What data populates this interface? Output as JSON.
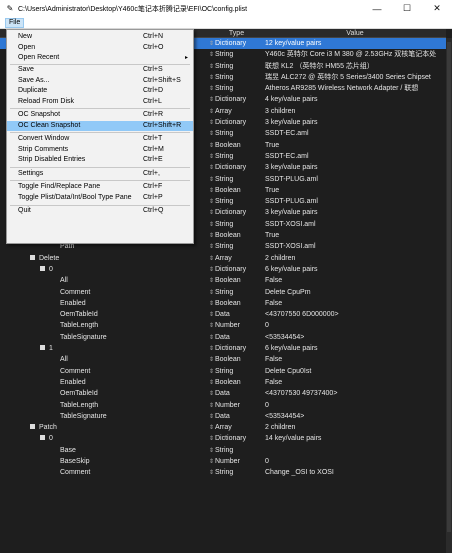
{
  "window": {
    "title": "C:\\Users\\Administrator\\Desktop\\Y460c笔记本折腾记录\\EFI\\OC\\config.plist",
    "app_icon": "pencil-icon",
    "minimize": "—",
    "maximize": "☐",
    "close": "✕"
  },
  "menubar": {
    "file": "File"
  },
  "columns": {
    "type": "Type",
    "value": "Value"
  },
  "rows": [
    {
      "key": "",
      "type": "Dictionary",
      "value": "12 key/value pairs",
      "selected": true
    },
    {
      "key": "",
      "type": "String",
      "value": "Y460c  英特尔 Core i3 M 380 @ 2.53GHz 双核笔记本处"
    },
    {
      "key": "",
      "type": "String",
      "value": "联想 KL2 （英特尔 HM55 芯片组）"
    },
    {
      "key": "",
      "type": "String",
      "value": "瑞昱 ALC272 @ 英特尔 5 Series/3400 Series Chipset"
    },
    {
      "key": "",
      "type": "String",
      "value": "Atheros AR9285 Wireless Network Adapter / 联想"
    },
    {
      "key": "",
      "type": "Dictionary",
      "value": "4 key/value pairs"
    },
    {
      "key": "",
      "type": "Array",
      "value": "3 children"
    },
    {
      "key": "",
      "type": "Dictionary",
      "value": "3 key/value pairs"
    },
    {
      "key": "",
      "type": "String",
      "value": "SSDT-EC.aml"
    },
    {
      "key": "",
      "type": "Boolean",
      "value": "True"
    },
    {
      "key": "",
      "type": "String",
      "value": "SSDT-EC.aml"
    },
    {
      "key": "",
      "type": "Dictionary",
      "value": "3 key/value pairs"
    },
    {
      "key": "",
      "type": "String",
      "value": "SSDT-PLUG.aml"
    },
    {
      "key": "",
      "type": "Boolean",
      "value": "True"
    },
    {
      "key": "",
      "type": "String",
      "value": "SSDT-PLUG.aml"
    },
    {
      "key": "",
      "type": "Dictionary",
      "value": "3 key/value pairs"
    },
    {
      "key": "Comment",
      "indent": 60,
      "type": "String",
      "value": "SSDT-XOSI.aml"
    },
    {
      "key": "Enabled",
      "indent": 60,
      "type": "Boolean",
      "value": "True"
    },
    {
      "key": "Path",
      "indent": 60,
      "type": "String",
      "value": "SSDT-XOSI.aml"
    },
    {
      "key": "Delete",
      "indent": 30,
      "toggle": true,
      "type": "Array",
      "value": "2 children"
    },
    {
      "key": "0",
      "indent": 40,
      "toggle": true,
      "type": "Dictionary",
      "value": "6 key/value pairs"
    },
    {
      "key": "All",
      "indent": 60,
      "type": "Boolean",
      "value": "False"
    },
    {
      "key": "Comment",
      "indent": 60,
      "type": "String",
      "value": "Delete CpuPm"
    },
    {
      "key": "Enabled",
      "indent": 60,
      "type": "Boolean",
      "value": "False"
    },
    {
      "key": "OemTableId",
      "indent": 60,
      "type": "Data",
      "value": "<43707550 6D000000>"
    },
    {
      "key": "TableLength",
      "indent": 60,
      "type": "Number",
      "value": "0"
    },
    {
      "key": "TableSignature",
      "indent": 60,
      "type": "Data",
      "value": "<53534454>"
    },
    {
      "key": "1",
      "indent": 40,
      "toggle": true,
      "type": "Dictionary",
      "value": "6 key/value pairs"
    },
    {
      "key": "All",
      "indent": 60,
      "type": "Boolean",
      "value": "False"
    },
    {
      "key": "Comment",
      "indent": 60,
      "type": "String",
      "value": "Delete Cpu0Ist"
    },
    {
      "key": "Enabled",
      "indent": 60,
      "type": "Boolean",
      "value": "False"
    },
    {
      "key": "OemTableId",
      "indent": 60,
      "type": "Data",
      "value": "<43707530 49737400>"
    },
    {
      "key": "TableLength",
      "indent": 60,
      "type": "Number",
      "value": "0"
    },
    {
      "key": "TableSignature",
      "indent": 60,
      "type": "Data",
      "value": "<53534454>"
    },
    {
      "key": "Patch",
      "indent": 30,
      "toggle": true,
      "type": "Array",
      "value": "2 children"
    },
    {
      "key": "0",
      "indent": 40,
      "toggle": true,
      "type": "Dictionary",
      "value": "14 key/value pairs"
    },
    {
      "key": "Base",
      "indent": 60,
      "type": "String",
      "value": ""
    },
    {
      "key": "BaseSkip",
      "indent": 60,
      "type": "Number",
      "value": "0"
    },
    {
      "key": "Comment",
      "indent": 60,
      "type": "String",
      "value": "Change _OSI to XOSI"
    }
  ],
  "file_menu": {
    "items": [
      {
        "label": "New",
        "shortcut": "Ctrl+N"
      },
      {
        "label": "Open",
        "shortcut": "Ctrl+O"
      },
      {
        "label": "Open Recent",
        "shortcut": "",
        "submenu": "▸"
      },
      {
        "label": "Save",
        "shortcut": "Ctrl+S"
      },
      {
        "label": "Save As...",
        "shortcut": "Ctrl+Shift+S"
      },
      {
        "label": "Duplicate",
        "shortcut": "Ctrl+D"
      },
      {
        "label": "Reload From Disk",
        "shortcut": "Ctrl+L"
      },
      {
        "label": "OC Snapshot",
        "shortcut": "Ctrl+R"
      },
      {
        "label": "OC Clean Snapshot",
        "shortcut": "Ctrl+Shift+R",
        "highlighted": true
      },
      {
        "label": "Convert Window",
        "shortcut": "Ctrl+T"
      },
      {
        "label": "Strip Comments",
        "shortcut": "Ctrl+M"
      },
      {
        "label": "Strip Disabled Entries",
        "shortcut": "Ctrl+E"
      },
      {
        "label": "Settings",
        "shortcut": "Ctrl+,"
      },
      {
        "label": "Toggle Find/Replace Pane",
        "shortcut": "Ctrl+F"
      },
      {
        "label": "Toggle Plist/Data/Int/Bool Type Pane",
        "shortcut": "Ctrl+P"
      },
      {
        "label": "Quit",
        "shortcut": "Ctrl+Q"
      }
    ]
  },
  "colors": {
    "selection": "#2f78d5",
    "menu_highlight": "#91c9f7",
    "background": "#1e1e1e"
  }
}
